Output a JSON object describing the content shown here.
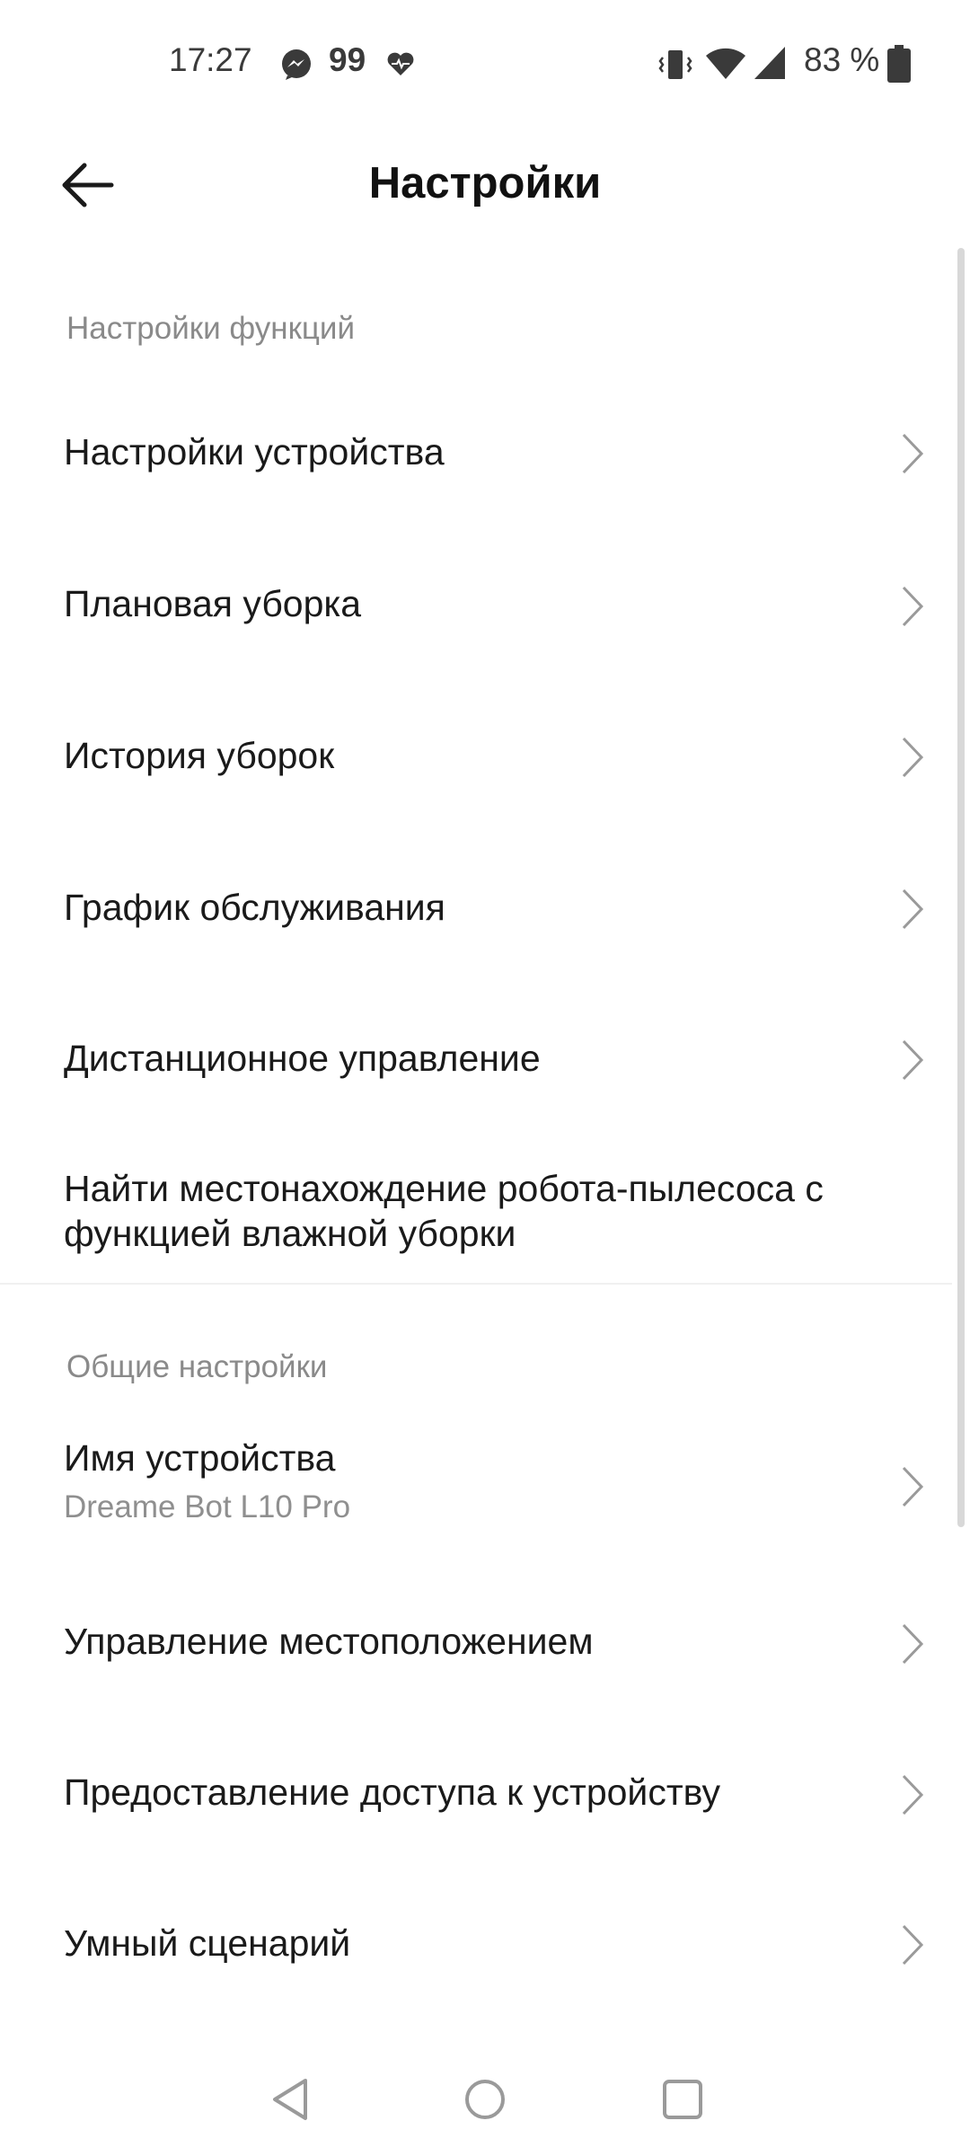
{
  "status_bar": {
    "time": "17:27",
    "notification_count": "99",
    "battery_percent": "83 %",
    "icons": [
      "messenger-icon",
      "heart-pulse-icon",
      "vibrate-icon",
      "wifi-icon",
      "signal-icon",
      "battery-icon"
    ]
  },
  "header": {
    "title": "Настройки",
    "back_icon": "arrow-left-icon"
  },
  "sections": {
    "functions": {
      "title": "Настройки функций",
      "items": [
        {
          "label": "Настройки устройства"
        },
        {
          "label": "Плановая уборка"
        },
        {
          "label": "История уборок"
        },
        {
          "label": "График обслуживания"
        },
        {
          "label": "Дистанционное управление"
        },
        {
          "label_line1": "Найти местонахождение робота-пылесоса с",
          "label_line2": "функцией влажной уборки"
        }
      ]
    },
    "general": {
      "title": "Общие настройки",
      "items": [
        {
          "label": "Имя устройства",
          "subtitle": "Dreame Bot L10 Pro"
        },
        {
          "label": "Управление местоположением"
        },
        {
          "label": "Предоставление доступа к устройству"
        },
        {
          "label": "Умный сценарий"
        }
      ]
    }
  },
  "nav_bar": {
    "icons": [
      "back-triangle-icon",
      "home-circle-icon",
      "recents-square-icon"
    ]
  },
  "colors": {
    "background": "#ffffff",
    "text_primary": "#1a1a1a",
    "text_secondary": "#8a8a8a",
    "chevron": "#9a9a9a"
  }
}
